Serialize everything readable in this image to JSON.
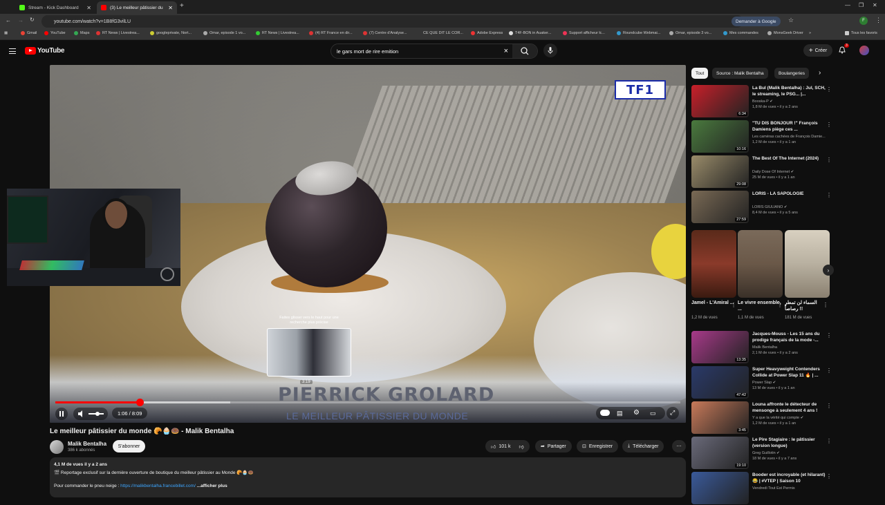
{
  "browser": {
    "tabs": [
      {
        "title": "Stream - Kick Dashboard",
        "color": "#53fc18"
      },
      {
        "title": "(3) Le meilleur pâtissier du",
        "color": "#ff0000"
      }
    ],
    "url": "youtube.com/watch?v=1B8fG3vilLU",
    "ask_google": "Demander à Google",
    "all_tabs": "Tous les favoris",
    "bookmarks": [
      "Gmail",
      "YouTube",
      "Maps",
      "RT News | Livestrea...",
      "googleprivate, Nort...",
      "Omar, episode 1 vo...",
      "RT News | Livestrea...",
      "(4) RT France en dir...",
      "(7) Centre d'Analyse...",
      "CE QUE DIT LE COR...",
      "Adobe Express",
      "T4F-BON in Auaker...",
      "Support afficheur lc...",
      "Roundcube Webmai...",
      "Omar, episode 3 vo...",
      "Mes commandes",
      "MonsGeek Driver"
    ]
  },
  "youtube": {
    "logo": "YouTube",
    "search_query": "le gars mort de rire emition",
    "create_label": "Créer",
    "notifications": "3"
  },
  "player": {
    "channel_logo": "TF1",
    "nameplate": "PIERRICK GROLARD",
    "subplate": "LE MEILLEUR PÂTISSIER DU MONDE",
    "hint": "Faites glisser vers le haut pour une recherche plus précise",
    "preview_time": "3:19",
    "time_display": "1:06 / 8:09",
    "progress": 0.135,
    "loaded": 0.28
  },
  "video": {
    "title": "Le meilleur pâtissier du monde 🥐🧁🍩 - Malik Bentalha",
    "channel": "Malik Bentalha",
    "subscribers": "386 k abonnés",
    "subscribe": "S'abonner",
    "likes": "101 k",
    "share": "Partager",
    "save": "Enregistrer",
    "download": "Télécharger",
    "views_date": "4,1 M de vues  il y a 2 ans",
    "desc_line1": "🎬 Reportage exclusif sur la dernière ouverture de boutique du meilleur pâtissier au Monde 🥐🧁🍩",
    "desc_line2_prefix": "Pour commander le pneu neige : ",
    "desc_link": "https://malikbentalha.francebillet.com/",
    "show_more": "...afficher plus"
  },
  "sidebar": {
    "chips": [
      "Tout",
      "Source : Malik Bentalha",
      "Boulangeries"
    ],
    "recs": [
      {
        "title": "La Bul (Malik Bentalha) : Jul, SCH, le streaming, le PSG... |...",
        "channel": "Booska-P ✔",
        "meta": "1,8 M de vues • il y a 2 ans",
        "duration": "6:34",
        "thumb": "#c8202a"
      },
      {
        "title": "\"TU DIS BONJOUR !\" François Damiens piège ces ...",
        "channel": "Les caméras cachées de François Damie...",
        "meta": "1,2 M de vues • il y a 1 an",
        "duration": "10:16",
        "thumb": "#4a7a3e"
      },
      {
        "title": "The Best Of The Internet (2024)",
        "channel": "Daily Dose Of Internet ✔",
        "meta": "25 M de vues • il y a 1 an",
        "duration": "29:08",
        "thumb": "#9a8c6a"
      },
      {
        "title": "LORIS - LA SAPOLOGIE",
        "channel": "LORIS GIULIANO ✔",
        "meta": "8,4 M de vues • il y a 5 ans",
        "duration": "27:59",
        "thumb": "#7a6a55"
      }
    ],
    "shorts": [
      {
        "title": "Jamel - L'Amiral ...",
        "views": "1,2 M de vues",
        "thumb": "#8a3a2a"
      },
      {
        "title": "Le vivre ensemble, ...",
        "views": "1,1 M de vues",
        "thumb": "#6a5848"
      },
      {
        "title": "السماء لن تمطر رصاصاً !!",
        "views": "181 M de vues",
        "thumb": "#b8b0a0"
      }
    ],
    "recs2": [
      {
        "title": "Jacques-Mouss - Les 15 ans du prodige français de la mode -...",
        "channel": "Malik Bentalha",
        "meta": "2,1 M de vues • il y a 2 ans",
        "duration": "13:35",
        "thumb": "#a83a8a"
      },
      {
        "title": "Super Heavyweight Contenders Collide at Power Slap 11 🔥 | ...",
        "channel": "Power Slap ✔",
        "meta": "13 M de vues • il y a 1 an",
        "duration": "47:42",
        "thumb": "#2a3a6a"
      },
      {
        "title": "Louna affronte le détecteur de mensonge à seulement 4 ans !",
        "channel": "Y a que la vérité qui compte ✔",
        "meta": "1,2 M de vues • il y a 1 an",
        "duration": "3:45",
        "thumb": "#c87a5a"
      },
      {
        "title": "Le Pire Stagiaire : le pâtissier (version longue)",
        "channel": "Greg Guillotin ✔",
        "meta": "18 M de vues • il y a 7 ans",
        "duration": "19:10",
        "thumb": "#6a6a7a"
      },
      {
        "title": "Booder est incroyable (et hilarant) 😂 | #VTEP | Saison 10",
        "channel": "Vendredi Tout Est Permis",
        "meta": "",
        "duration": "",
        "thumb": "#3a5a9a"
      }
    ]
  }
}
